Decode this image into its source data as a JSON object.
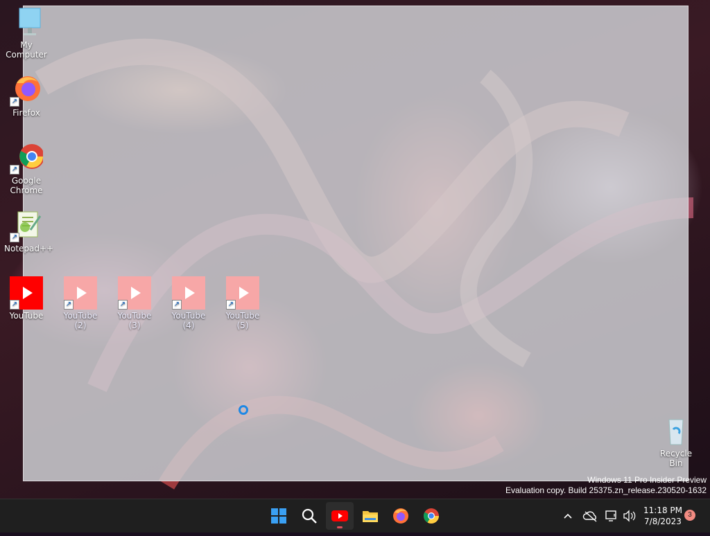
{
  "desktop": {
    "icons": {
      "my_computer": "My Computer",
      "firefox": "Firefox",
      "chrome": "Google Chrome",
      "notepadpp": "Notepad++",
      "youtube_1": "YouTube",
      "youtube_2": "YouTube (2)",
      "youtube_3": "YouTube (3)",
      "youtube_4": "YouTube (4)",
      "youtube_5": "YouTube (5)",
      "recycle_bin": "Recycle Bin"
    },
    "watermark": {
      "line1": "Windows 11 Pro Insider Preview",
      "line2": "Evaluation copy. Build 25375.zn_release.230520-1632"
    }
  },
  "taskbar": {
    "pinned": [
      "start-icon",
      "search-icon",
      "youtube-icon",
      "file-explorer-icon",
      "firefox-icon",
      "chrome-icon"
    ],
    "active_app": "youtube-icon",
    "clock": {
      "time": "11:18 PM",
      "date": "7/8/2023"
    },
    "notification_count": "3"
  },
  "colors": {
    "taskbar_bg": "#1f1f1f",
    "selection_overlay": "#cdcdd2",
    "youtube_red": "#ff0000",
    "accent": "#1e88e5"
  }
}
